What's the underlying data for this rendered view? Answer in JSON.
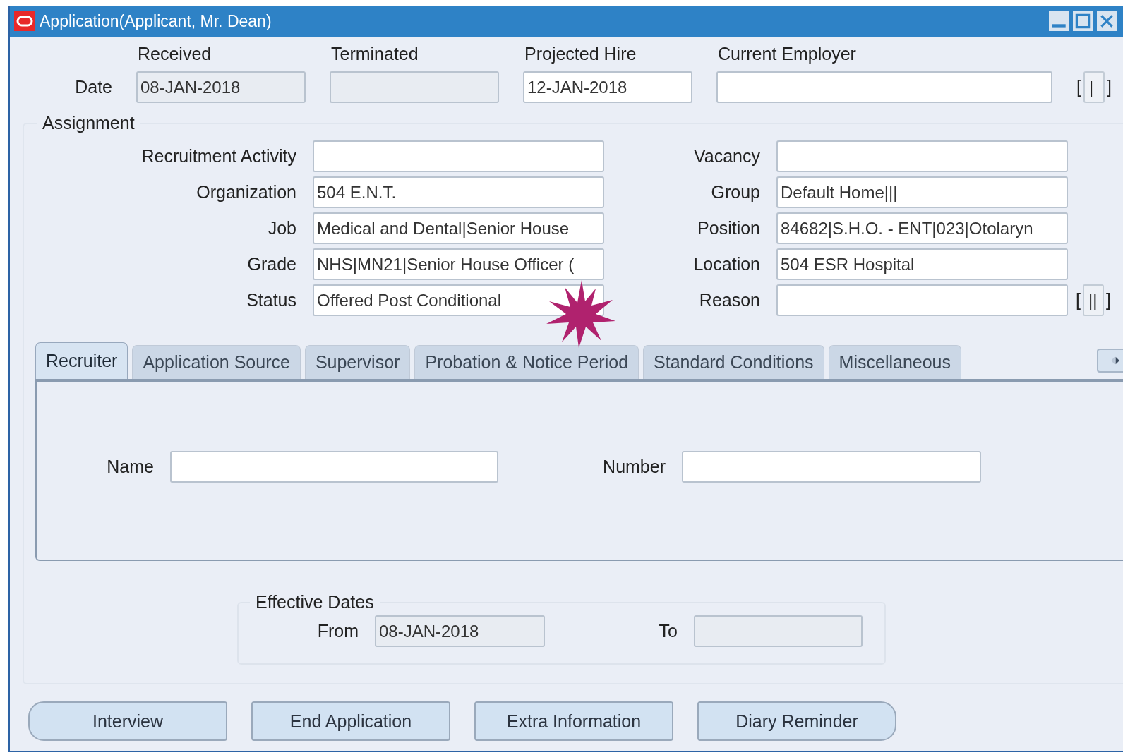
{
  "window": {
    "title": "Application(Applicant, Mr. Dean)"
  },
  "dates": {
    "row_label": "Date",
    "fields": [
      {
        "label": "Received",
        "value": "08-JAN-2018",
        "readonly": true
      },
      {
        "label": "Terminated",
        "readonly": true
      },
      {
        "label": "Projected Hire",
        "value": "12-JAN-2018",
        "readonly": false
      },
      {
        "label": "Current Employer",
        "readonly": false
      }
    ],
    "flexfield": {
      "open": "[",
      "value": "|",
      "close": "]"
    }
  },
  "assignment": {
    "title": "Assignment",
    "left": [
      {
        "label": "Recruitment Activity"
      },
      {
        "label": "Organization",
        "value": "504 E.N.T."
      },
      {
        "label": "Job",
        "value": "Medical and Dental|Senior House"
      },
      {
        "label": "Grade",
        "value": "NHS|MN21|Senior House Officer ("
      },
      {
        "label": "Status",
        "value": "Offered Post Conditional"
      }
    ],
    "right": [
      {
        "label": "Vacancy"
      },
      {
        "label": "Group",
        "value": "Default Home|||"
      },
      {
        "label": "Position",
        "value": "84682|S.H.O. - ENT|023|Otolaryn"
      },
      {
        "label": "Location",
        "value": "504 ESR Hospital"
      },
      {
        "label": "Reason"
      }
    ],
    "flexfield": {
      "open": "[",
      "value": "||",
      "close": "]"
    },
    "tabs": [
      {
        "label": "Recruiter",
        "selected": true
      },
      {
        "label": "Application Source",
        "selected": false
      },
      {
        "label": "Supervisor",
        "selected": false
      },
      {
        "label": "Probation & Notice Period",
        "selected": false
      },
      {
        "label": "Standard Conditions",
        "selected": false
      },
      {
        "label": "Miscellaneous",
        "selected": false
      }
    ],
    "panel": {
      "fields": [
        {
          "label": "Name"
        },
        {
          "label": "Number"
        }
      ]
    },
    "effective_dates": {
      "title": "Effective Dates",
      "fields": [
        {
          "label": "From",
          "value": "08-JAN-2018",
          "readonly": true
        },
        {
          "label": "To",
          "readonly": true
        }
      ]
    }
  },
  "buttons": [
    "Interview",
    "End Application",
    "Extra Information",
    "Diary Reminder"
  ]
}
